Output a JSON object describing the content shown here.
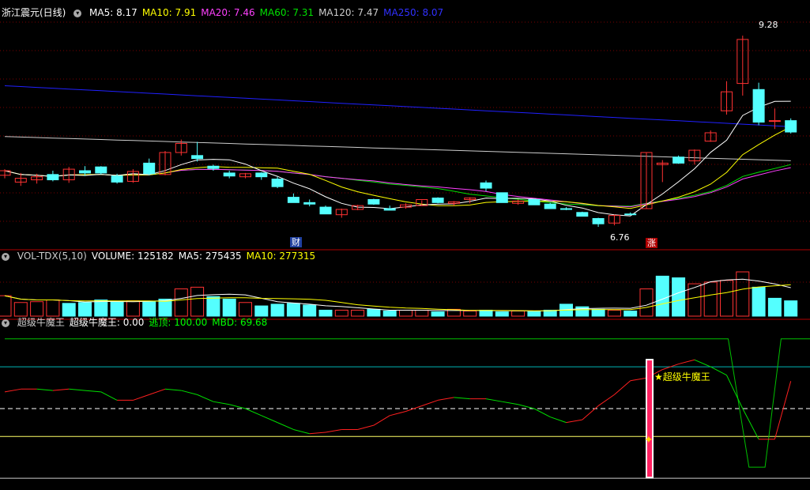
{
  "colors": {
    "up": "#ff3232",
    "down": "#54ffff",
    "ma5": "#ffffff",
    "ma10": "#ffff00",
    "ma20": "#ff40ff",
    "ma60": "#00e000",
    "ma120": "#cccccc",
    "ma250": "#2020ff",
    "grid": "#7a0000",
    "cyanline": "#00b4b4"
  },
  "price_header": {
    "stock_name": "浙江震元(日线)",
    "items": [
      {
        "label": "MA5: 8.17",
        "color": "#ffffff"
      },
      {
        "label": "MA10: 7.91",
        "color": "#ffff00"
      },
      {
        "label": "MA20: 7.46",
        "color": "#ff40ff"
      },
      {
        "label": "MA60: 7.31",
        "color": "#00e000"
      },
      {
        "label": "MA120: 7.47",
        "color": "#cccccc"
      },
      {
        "label": "MA250: 8.07",
        "color": "#3030ff"
      }
    ]
  },
  "volume_header": {
    "items": [
      {
        "label": "VOL-TDX(5,10)",
        "color": "#cccccc"
      },
      {
        "label": "VOLUME: 125182",
        "color": "#ffffff"
      },
      {
        "label": "MA5: 275435",
        "color": "#ffffff"
      },
      {
        "label": "MA10: 277315",
        "color": "#ffff00"
      }
    ]
  },
  "indicator_header": {
    "items": [
      {
        "label": "超级牛魔王",
        "color": "#cccccc"
      },
      {
        "label": "超级牛魔王: 0.00",
        "color": "#ffffff"
      },
      {
        "label": "逃顶: 100.00",
        "color": "#00ff00"
      },
      {
        "label": "MBD: 69.68",
        "color": "#00ff00"
      }
    ]
  },
  "annotations": {
    "high_label": "9.28",
    "low_label": "6.76",
    "cai_badge": "财",
    "zhang_badge": "涨",
    "signal_label": "★超级牛魔王"
  },
  "chart_data": [
    {
      "type": "candlestick",
      "title": "浙江震元(日线)",
      "ylim": [
        6.5,
        9.5
      ],
      "candles": [
        [
          7.44,
          7.52,
          7.4,
          7.5
        ],
        [
          7.35,
          7.47,
          7.3,
          7.4
        ],
        [
          7.38,
          7.46,
          7.33,
          7.42
        ],
        [
          7.45,
          7.5,
          7.36,
          7.38
        ],
        [
          7.38,
          7.55,
          7.34,
          7.52
        ],
        [
          7.5,
          7.56,
          7.43,
          7.47
        ],
        [
          7.55,
          7.56,
          7.45,
          7.47
        ],
        [
          7.43,
          7.46,
          7.33,
          7.35
        ],
        [
          7.36,
          7.52,
          7.34,
          7.49
        ],
        [
          7.6,
          7.66,
          7.44,
          7.46
        ],
        [
          7.45,
          7.76,
          7.44,
          7.74
        ],
        [
          7.74,
          7.91,
          7.7,
          7.86
        ],
        [
          7.7,
          7.88,
          7.62,
          7.66
        ],
        [
          7.56,
          7.58,
          7.5,
          7.53
        ],
        [
          7.47,
          7.5,
          7.4,
          7.43
        ],
        [
          7.42,
          7.47,
          7.4,
          7.46
        ],
        [
          7.47,
          7.48,
          7.38,
          7.42
        ],
        [
          7.39,
          7.42,
          7.27,
          7.29
        ],
        [
          7.15,
          7.2,
          7.08,
          7.08
        ],
        [
          7.08,
          7.12,
          7.03,
          7.06
        ],
        [
          7.02,
          7.04,
          6.93,
          6.93
        ],
        [
          6.92,
          7.0,
          6.88,
          6.99
        ],
        [
          6.99,
          7.05,
          6.98,
          7.04
        ],
        [
          7.12,
          7.13,
          7.05,
          7.06
        ],
        [
          7.0,
          7.04,
          6.98,
          6.98
        ],
        [
          7.02,
          7.07,
          7.0,
          7.05
        ],
        [
          7.04,
          7.11,
          7.04,
          7.12
        ],
        [
          7.14,
          7.15,
          7.07,
          7.08
        ],
        [
          7.07,
          7.1,
          7.04,
          7.09
        ],
        [
          7.12,
          7.15,
          7.07,
          7.14
        ],
        [
          7.34,
          7.37,
          7.23,
          7.27
        ],
        [
          7.21,
          7.21,
          7.08,
          7.08
        ],
        [
          7.07,
          7.12,
          7.05,
          7.1
        ],
        [
          7.12,
          7.13,
          7.05,
          7.05
        ],
        [
          7.06,
          7.08,
          7.0,
          7.0
        ],
        [
          7.0,
          7.02,
          6.98,
          6.99
        ],
        [
          6.95,
          6.96,
          6.9,
          6.9
        ],
        [
          6.87,
          6.88,
          6.76,
          6.8
        ],
        [
          6.81,
          6.92,
          6.78,
          6.91
        ],
        [
          6.93,
          6.95,
          6.92,
          6.92
        ],
        [
          7.0,
          7.74,
          7.0,
          7.74
        ],
        [
          7.58,
          7.64,
          7.35,
          7.6
        ],
        [
          7.68,
          7.7,
          7.59,
          7.6
        ],
        [
          7.63,
          7.78,
          7.58,
          7.77
        ],
        [
          7.89,
          8.03,
          7.88,
          8.0
        ],
        [
          8.29,
          8.68,
          8.24,
          8.54
        ],
        [
          8.65,
          9.28,
          8.49,
          9.23
        ],
        [
          8.57,
          8.66,
          8.1,
          8.14
        ],
        [
          8.16,
          8.32,
          8.05,
          8.16
        ],
        [
          8.16,
          8.19,
          7.99,
          8.01
        ]
      ]
    },
    {
      "type": "bar",
      "title": "VOL-TDX(5,10)",
      "ylim": [
        0,
        650000
      ],
      "values": [
        240000,
        160000,
        170000,
        190000,
        150000,
        160000,
        190000,
        170000,
        180000,
        170000,
        200000,
        320000,
        340000,
        230000,
        200000,
        160000,
        120000,
        140000,
        150000,
        130000,
        70000,
        70000,
        70000,
        80000,
        60000,
        70000,
        70000,
        50000,
        80000,
        60000,
        70000,
        50000,
        60000,
        60000,
        70000,
        140000,
        110000,
        80000,
        70000,
        60000,
        320000,
        470000,
        450000,
        380000,
        400000,
        420000,
        520000,
        340000,
        210000,
        180000
      ],
      "up_flags": [
        1,
        1,
        1,
        1,
        0,
        0,
        0,
        0,
        1,
        0,
        0,
        1,
        1,
        0,
        0,
        1,
        0,
        0,
        0,
        0,
        0,
        1,
        1,
        0,
        0,
        1,
        1,
        0,
        1,
        1,
        0,
        0,
        1,
        0,
        0,
        0,
        0,
        0,
        1,
        0,
        1,
        0,
        0,
        1,
        1,
        1,
        1,
        0,
        0,
        0
      ]
    },
    {
      "type": "line",
      "title": "超级牛魔王",
      "ylim": [
        -5,
        105
      ],
      "levels": [
        100,
        80,
        50,
        30
      ],
      "series": [
        {
          "name": "逃顶",
          "values": [
            100,
            100,
            100,
            100,
            100,
            100,
            100,
            100,
            100,
            100,
            100,
            100,
            100,
            100,
            100,
            100,
            100,
            100,
            100,
            100,
            100,
            100,
            100,
            100,
            100,
            100,
            100,
            100,
            100,
            100,
            100,
            100,
            100,
            100,
            100,
            100,
            100,
            100,
            100,
            100,
            100,
            100,
            100,
            100,
            100,
            100,
            100,
            100,
            100,
            100
          ]
        },
        {
          "name": "MBD",
          "values": [
            62,
            64,
            64,
            63,
            64,
            63,
            62,
            56,
            56,
            60,
            64,
            63,
            60,
            55,
            53,
            50,
            45,
            40,
            35,
            32,
            33,
            35,
            35,
            38,
            45,
            48,
            52,
            56,
            58,
            57,
            57,
            55,
            53,
            50,
            44,
            40,
            42,
            52,
            60,
            70,
            72,
            78,
            82,
            85,
            80,
            74,
            50,
            28,
            28,
            69.68
          ]
        }
      ],
      "signal_index": 40
    }
  ]
}
